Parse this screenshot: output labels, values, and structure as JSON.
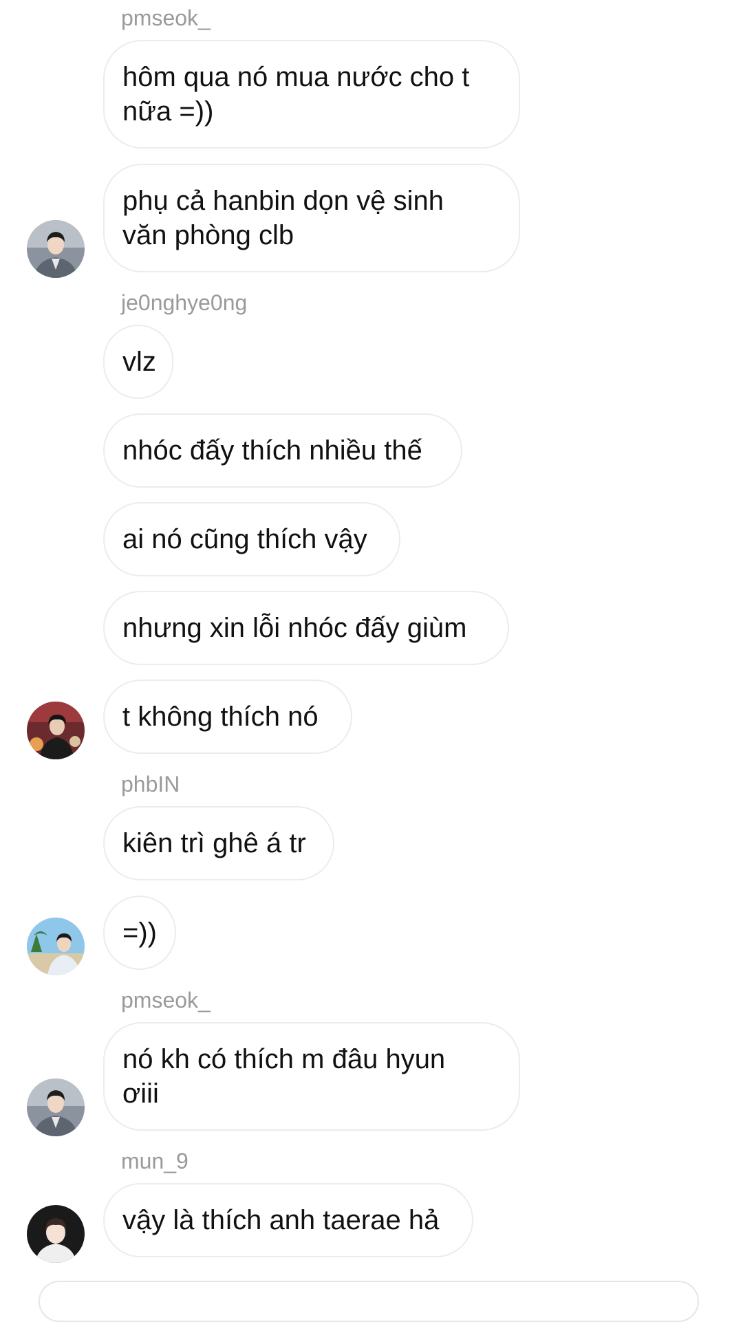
{
  "chat": {
    "groups": [
      {
        "username": "pmseok_",
        "messages": [
          "hôm qua nó mua nước cho t\nnữa =))",
          "phụ cả hanbin dọn vệ sinh\nvăn phòng clb"
        ],
        "avatar": "user-avatar-pmseok-icon"
      },
      {
        "username": "je0nghye0ng",
        "messages": [
          "vlz",
          "nhóc đấy thích nhiều thế",
          "ai nó cũng thích vậy",
          "nhưng xin lỗi nhóc đấy giùm",
          "t không thích nó"
        ],
        "avatar": "user-avatar-je0nghye0ng-icon"
      },
      {
        "username": "phbIN",
        "messages": [
          "kiên trì ghê á tr",
          "=))"
        ],
        "avatar": "user-avatar-phbin-icon"
      },
      {
        "username": "pmseok_",
        "messages": [
          "nó kh có thích m đâu hyun\nơiii"
        ],
        "avatar": "user-avatar-pmseok-icon"
      },
      {
        "username": "mun_9",
        "messages": [
          "vậy là thích anh taerae hả"
        ],
        "avatar": "user-avatar-mun9-icon"
      }
    ]
  },
  "colors": {
    "username": "#9a9a9a",
    "bubble_border": "#ececec",
    "text": "#111111",
    "background": "#ffffff"
  }
}
